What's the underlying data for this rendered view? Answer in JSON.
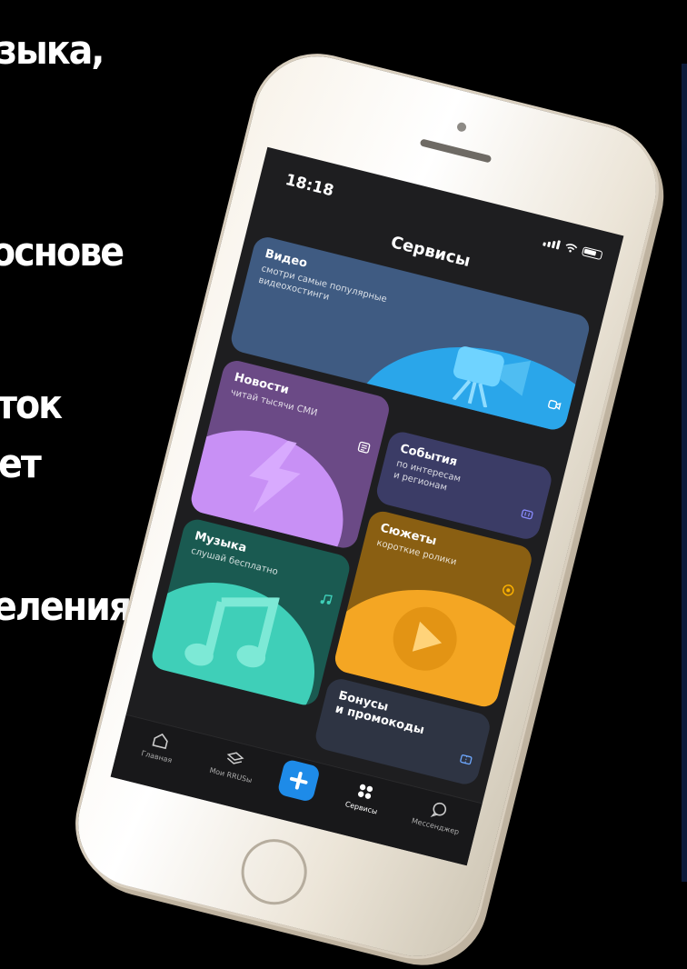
{
  "background_text": [
    "зыка,",
    "основе",
    "ток",
    "ет",
    "еления"
  ],
  "status": {
    "time": "18:18"
  },
  "header": {
    "title": "Сервисы"
  },
  "cards": {
    "video": {
      "title": "Видео",
      "subtitle": "смотри самые популярные\nвидеохостинги"
    },
    "news": {
      "title": "Новости",
      "subtitle": "читай тысячи СМИ"
    },
    "events": {
      "title": "События",
      "subtitle": "по интересам\nи регионам"
    },
    "stories": {
      "title": "Сюжеты",
      "subtitle": "короткие ролики"
    },
    "music": {
      "title": "Музыка",
      "subtitle": "слушай бесплатно"
    },
    "bonus": {
      "title": "Бонусы\nи промокоды"
    }
  },
  "tabbar": {
    "home": "Главная",
    "my": "Мои RRUSы",
    "services": "Сервисы",
    "messenger": "Мессенджер"
  },
  "colors": {
    "video": "#3f5b82",
    "news": "#6b4a86",
    "events": "#3b3c66",
    "stories": "#8a5f12",
    "music": "#1a5a51",
    "bonus": "#2e3443",
    "accent": "#1e8be8"
  }
}
